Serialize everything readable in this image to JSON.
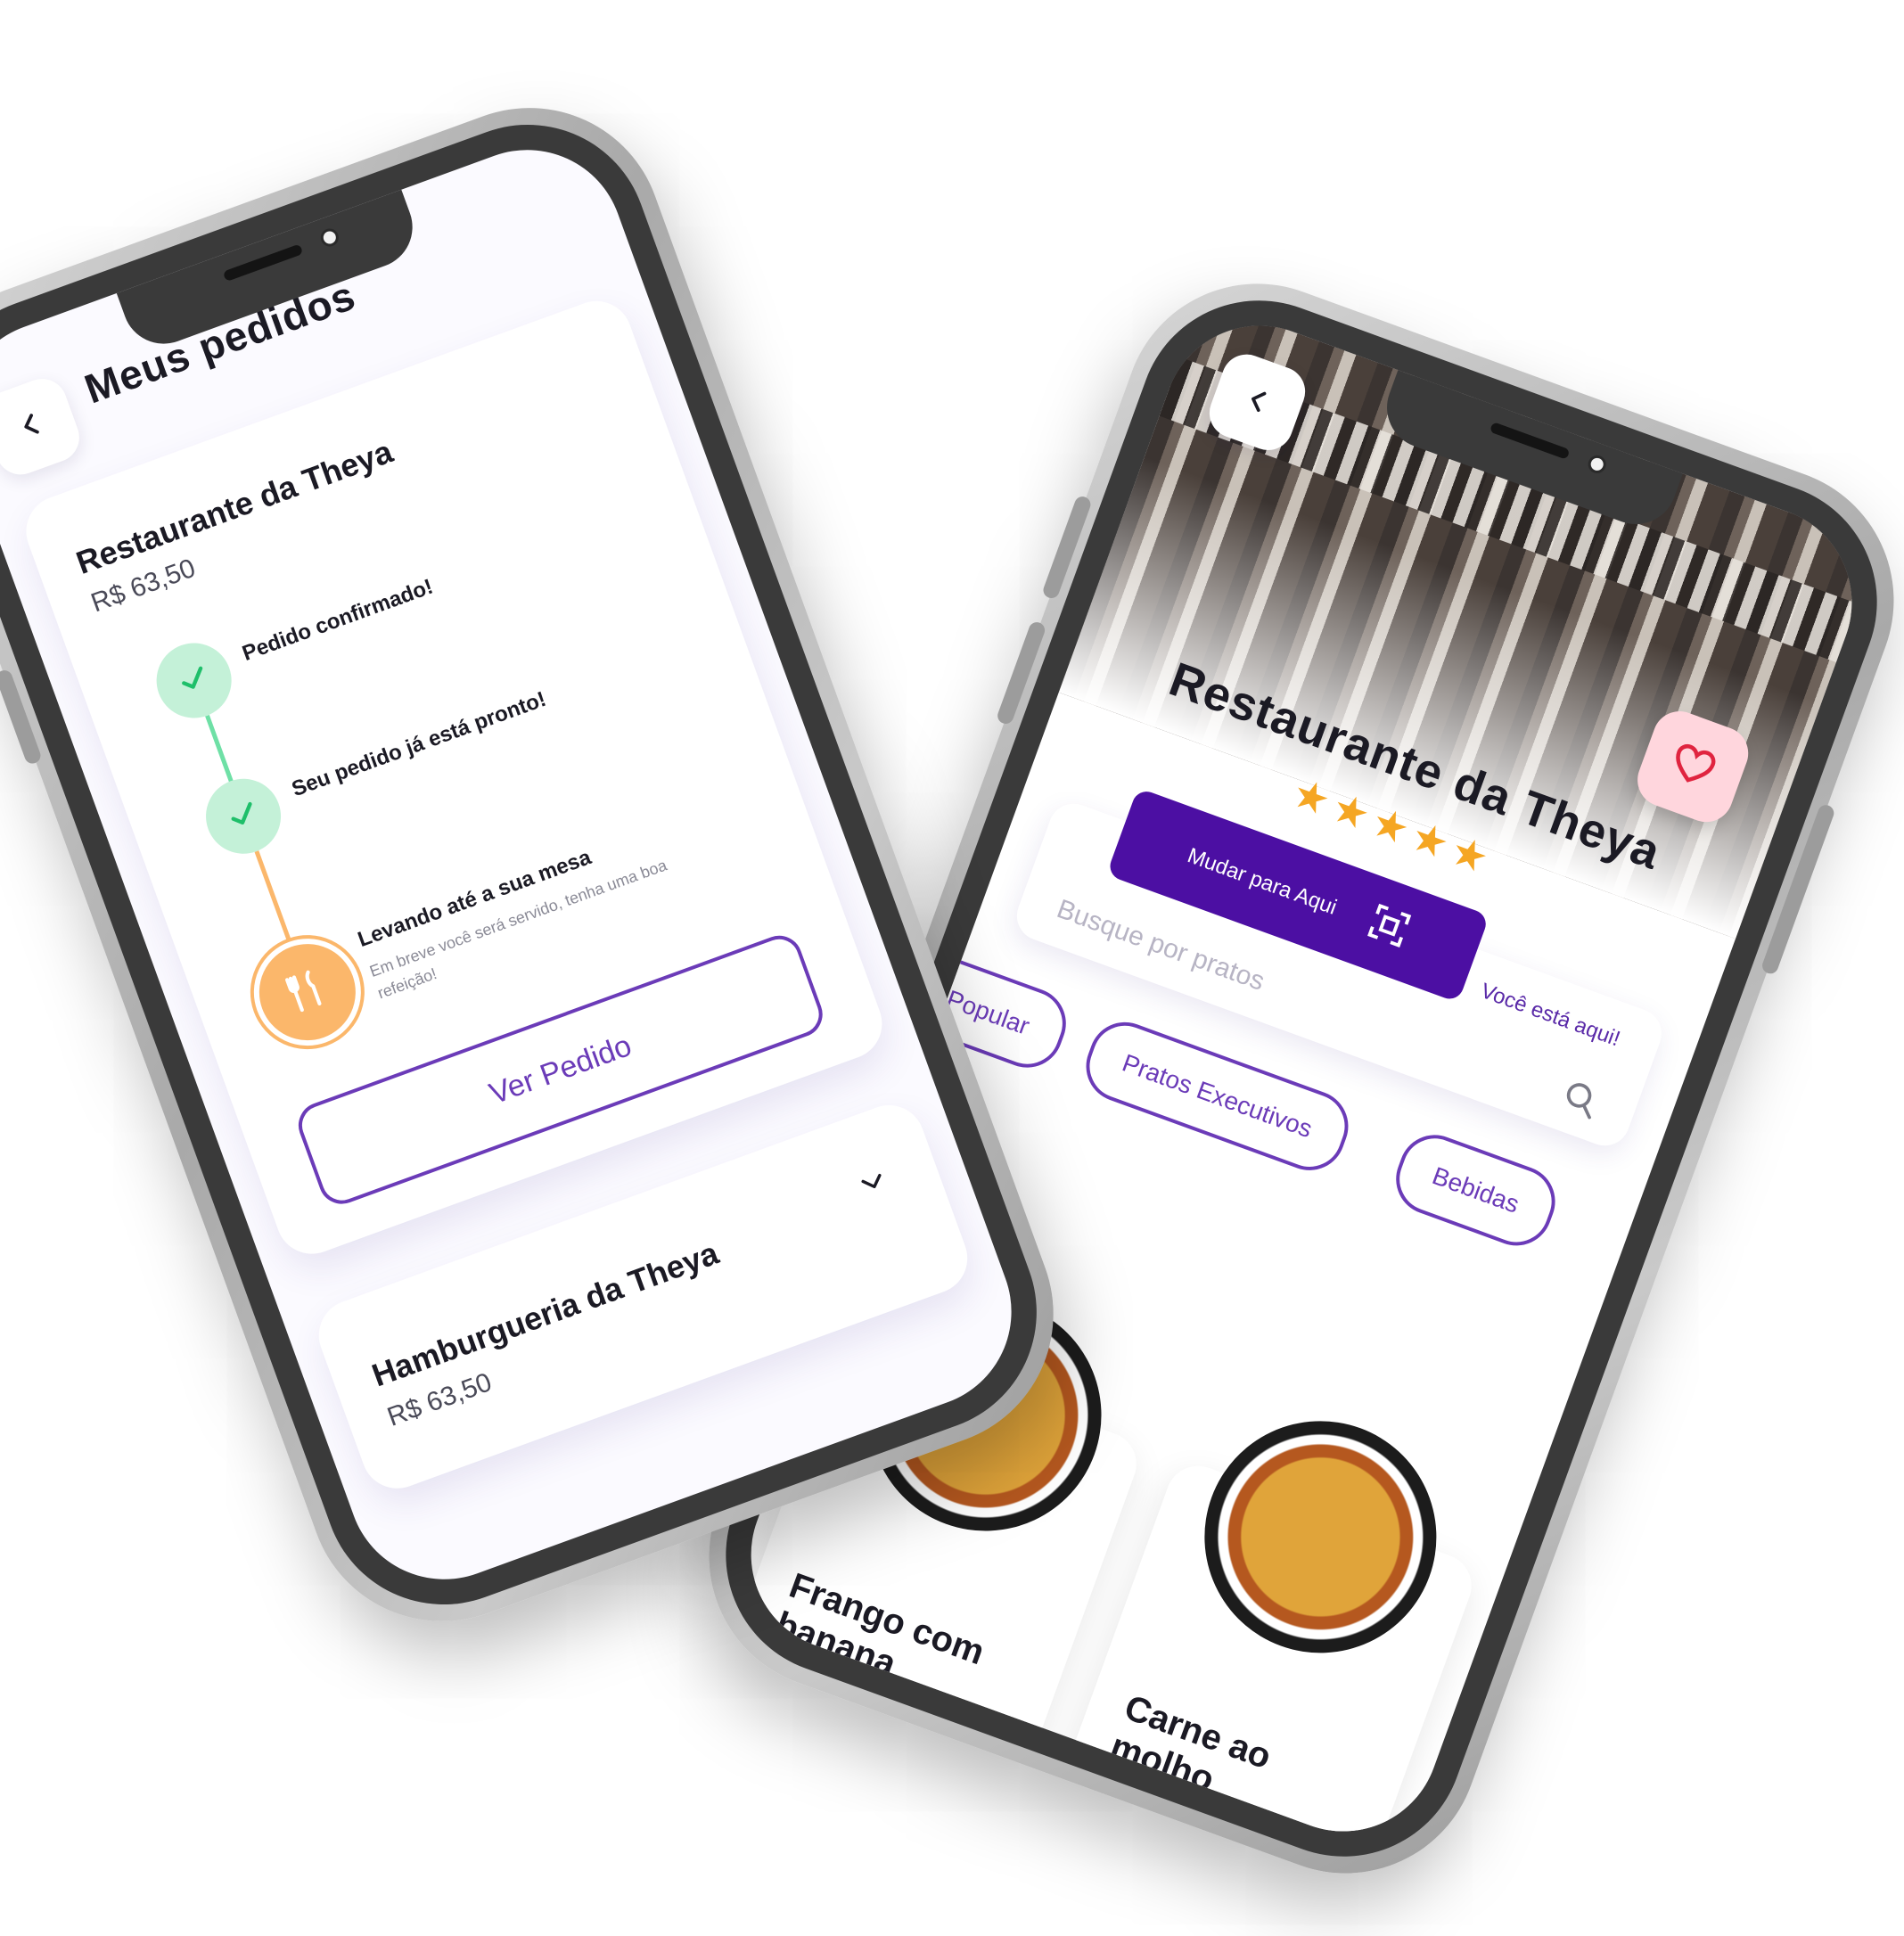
{
  "orders_screen": {
    "title": "Meus pedidos",
    "back_icon": "chevron-left-icon",
    "orders": [
      {
        "restaurant": "Restaurante da Theya",
        "price": "R$ 63,50",
        "steps": [
          {
            "label": "Pedido confirmado!",
            "status": "done",
            "icon": "check-icon"
          },
          {
            "label": "Seu pedido já está pronto!",
            "status": "done",
            "icon": "check-icon"
          },
          {
            "label": "Levando até a sua mesa",
            "sub": "Em breve você será servido, tenha uma boa refeição!",
            "status": "active",
            "icon": "cutlery-icon"
          }
        ],
        "action": "Ver Pedido"
      },
      {
        "restaurant": "Hamburgueria da Theya",
        "price": "R$ 63,50",
        "collapsed_icon": "chevron-down-icon"
      }
    ],
    "colors": {
      "accent": "#6b3bb8",
      "done": "#c4f1d8",
      "check": "#1fbf6a",
      "active": "#fbb76b"
    }
  },
  "restaurant_screen": {
    "name": "Restaurante da Theya",
    "rating": 5,
    "stars": "★★★★★",
    "back_icon": "chevron-left-icon",
    "favorite_icon": "heart-icon",
    "location_button": "Mudar para Aqui",
    "location_icon": "qr-code-icon",
    "location_note": "Você está aqui!",
    "search": {
      "placeholder": "Busque por pratos",
      "icon": "search-icon"
    },
    "categories": [
      "Popular",
      "Pratos Executivos",
      "Bebidas"
    ],
    "dishes": [
      {
        "name": "Frango com banana"
      },
      {
        "name": "Carne ao molho"
      }
    ],
    "colors": {
      "primary": "#4c0fa3",
      "star": "#f5a623",
      "favorite_bg": "#ffd6dd"
    }
  }
}
